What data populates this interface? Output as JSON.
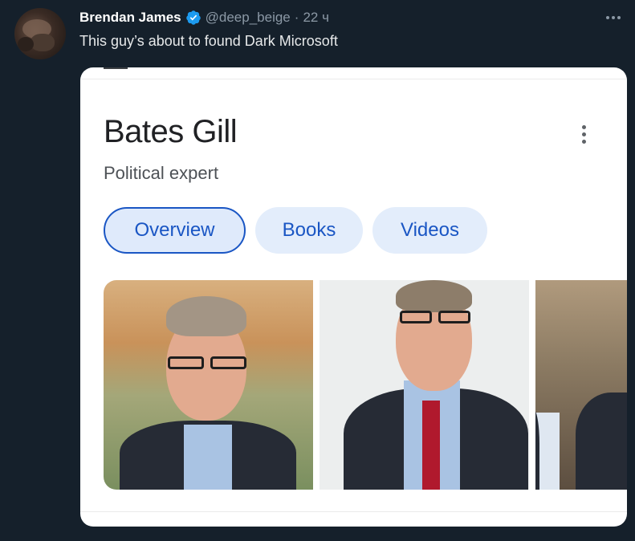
{
  "tweet": {
    "author_name": "Brendan James",
    "handle": "@deep_beige",
    "separator": "·",
    "time": "22 ч",
    "text": "This guy’s about to found Dark Microsoft",
    "verified_color": "#1d9bf0"
  },
  "knowledge_card": {
    "title": "Bates Gill",
    "subtitle": "Political expert",
    "chips": [
      {
        "label": "Overview",
        "active": true
      },
      {
        "label": "Books",
        "active": false
      },
      {
        "label": "Videos",
        "active": false
      }
    ],
    "accent_color": "#1a56c4"
  }
}
